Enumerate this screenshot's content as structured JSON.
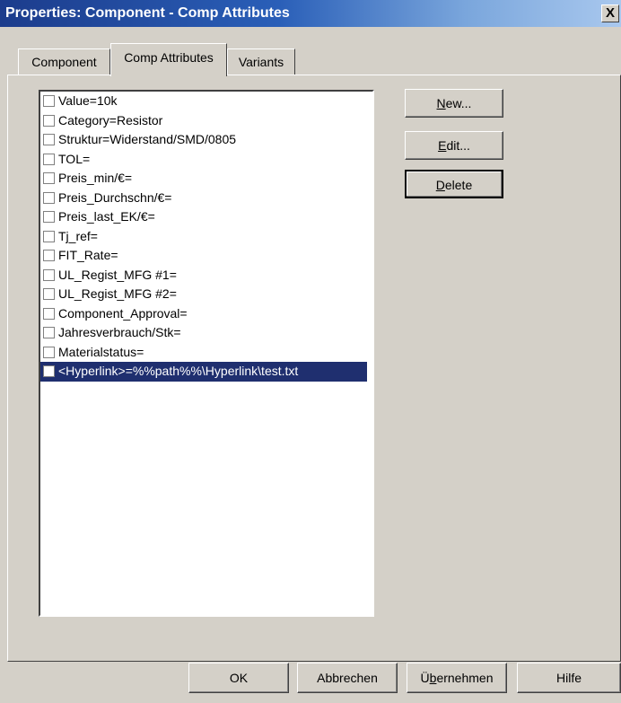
{
  "window": {
    "title": "Properties: Component - Comp Attributes",
    "close_glyph": "X"
  },
  "tabs": [
    {
      "label": "Component",
      "active": false
    },
    {
      "label": "Comp Attributes",
      "active": true
    },
    {
      "label": "Variants",
      "active": false
    }
  ],
  "attributes": [
    {
      "text": "Value=10k",
      "checked": false,
      "selected": false
    },
    {
      "text": "Category=Resistor",
      "checked": false,
      "selected": false
    },
    {
      "text": "Struktur=Widerstand/SMD/0805",
      "checked": false,
      "selected": false
    },
    {
      "text": "TOL=",
      "checked": false,
      "selected": false
    },
    {
      "text": "Preis_min/€=",
      "checked": false,
      "selected": false
    },
    {
      "text": "Preis_Durchschn/€=",
      "checked": false,
      "selected": false
    },
    {
      "text": "Preis_last_EK/€=",
      "checked": false,
      "selected": false
    },
    {
      "text": "Tj_ref=",
      "checked": false,
      "selected": false
    },
    {
      "text": "FIT_Rate=",
      "checked": false,
      "selected": false
    },
    {
      "text": "UL_Regist_MFG #1=",
      "checked": false,
      "selected": false
    },
    {
      "text": "UL_Regist_MFG #2=",
      "checked": false,
      "selected": false
    },
    {
      "text": "Component_Approval=",
      "checked": false,
      "selected": false
    },
    {
      "text": "Jahresverbrauch/Stk=",
      "checked": false,
      "selected": false
    },
    {
      "text": "Materialstatus=",
      "checked": false,
      "selected": false
    },
    {
      "text": "<Hyperlink>=%%path%%\\Hyperlink\\test.txt",
      "checked": false,
      "selected": true
    }
  ],
  "side_buttons": {
    "new": {
      "mnemonic": "N",
      "rest": "ew..."
    },
    "edit": {
      "mnemonic": "E",
      "rest": "dit..."
    },
    "delete": {
      "mnemonic": "D",
      "rest": "elete"
    }
  },
  "footer_buttons": {
    "ok": "OK",
    "cancel": "Abbrechen",
    "apply_first": "Ü",
    "apply_mnemonic": "b",
    "apply_rest": "ernehmen",
    "help": "Hilfe"
  },
  "colors": {
    "face": "#d4d0c8",
    "titlebar_start": "#1c3c8c",
    "selection": "#1f2f6f"
  }
}
